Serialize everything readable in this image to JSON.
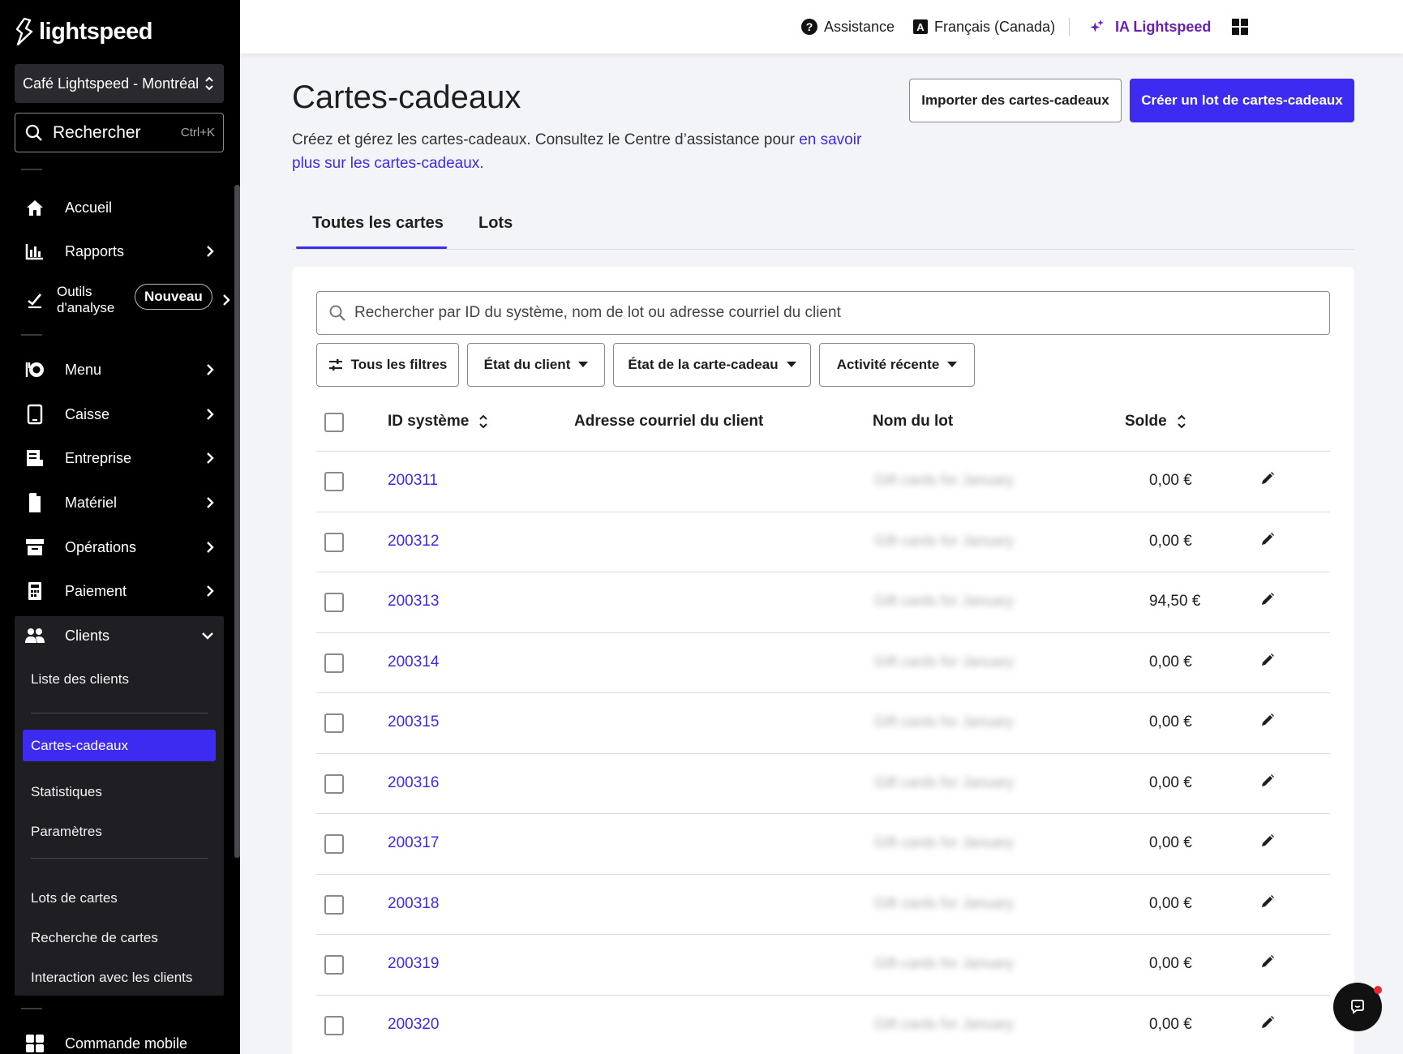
{
  "app": {
    "logo_text": "lightspeed"
  },
  "sidebar": {
    "store": "Café Lightspeed - Montréal",
    "search_label": "Rechercher",
    "search_shortcut": "Ctrl+K",
    "items": [
      {
        "label": "Accueil"
      },
      {
        "label": "Rapports"
      },
      {
        "label": "Outils\nd'analyse",
        "line1": "Outils",
        "line2": "d'analyse",
        "badge": "Nouveau"
      },
      {
        "label": "Menu"
      },
      {
        "label": "Caisse"
      },
      {
        "label": "Entreprise"
      },
      {
        "label": "Matériel"
      },
      {
        "label": "Opérations"
      },
      {
        "label": "Paiement"
      },
      {
        "label": "Clients"
      },
      {
        "label": "Commande mobile"
      }
    ],
    "clients_sub": [
      {
        "label": "Liste des clients"
      },
      {
        "label": "Cartes-cadeaux"
      },
      {
        "label": "Statistiques"
      },
      {
        "label": "Paramètres"
      },
      {
        "label": "Lots de cartes"
      },
      {
        "label": "Recherche de cartes"
      },
      {
        "label": "Interaction avec les clients"
      }
    ]
  },
  "topbar": {
    "assistance": "Assistance",
    "language": "Français (Canada)",
    "ai": "IA Lightspeed"
  },
  "page": {
    "title": "Cartes-cadeaux",
    "desc_text": "Créez et gérez les cartes-cadeaux. Consultez le Centre d’assistance pour ",
    "desc_link": "en savoir plus sur les cartes-cadeaux.",
    "import_button": "Importer des cartes-cadeaux",
    "create_button": "Créer un lot de cartes-cadeaux",
    "accent_color": "#3d2bf2"
  },
  "tabs": [
    {
      "label": "Toutes les cartes"
    },
    {
      "label": "Lots"
    }
  ],
  "search": {
    "placeholder": "Rechercher par ID du système, nom de lot ou adresse courriel du client"
  },
  "filters": [
    {
      "label": "Tous les filtres"
    },
    {
      "label": "État du client"
    },
    {
      "label": "État de la carte-cadeau"
    },
    {
      "label": "Activité récente"
    }
  ],
  "table": {
    "columns": [
      "ID système",
      "Adresse courriel du client",
      "Nom du lot",
      "Solde"
    ],
    "rows": [
      {
        "id": "200311",
        "email": "",
        "lot": "Gift cards for January",
        "solde": "0,00 €"
      },
      {
        "id": "200312",
        "email": "",
        "lot": "Gift cards for January",
        "solde": "0,00 €"
      },
      {
        "id": "200313",
        "email": "",
        "lot": "Gift cards for January",
        "solde": "94,50 €"
      },
      {
        "id": "200314",
        "email": "",
        "lot": "Gift cards for January",
        "solde": "0,00 €"
      },
      {
        "id": "200315",
        "email": "",
        "lot": "Gift cards for January",
        "solde": "0,00 €"
      },
      {
        "id": "200316",
        "email": "",
        "lot": "Gift cards for January",
        "solde": "0,00 €"
      },
      {
        "id": "200317",
        "email": "",
        "lot": "Gift cards for January",
        "solde": "0,00 €"
      },
      {
        "id": "200318",
        "email": "",
        "lot": "Gift cards for January",
        "solde": "0,00 €"
      },
      {
        "id": "200319",
        "email": "",
        "lot": "Gift cards for January",
        "solde": "0,00 €"
      },
      {
        "id": "200320",
        "email": "",
        "lot": "Gift cards for January",
        "solde": "0,00 €"
      }
    ]
  }
}
